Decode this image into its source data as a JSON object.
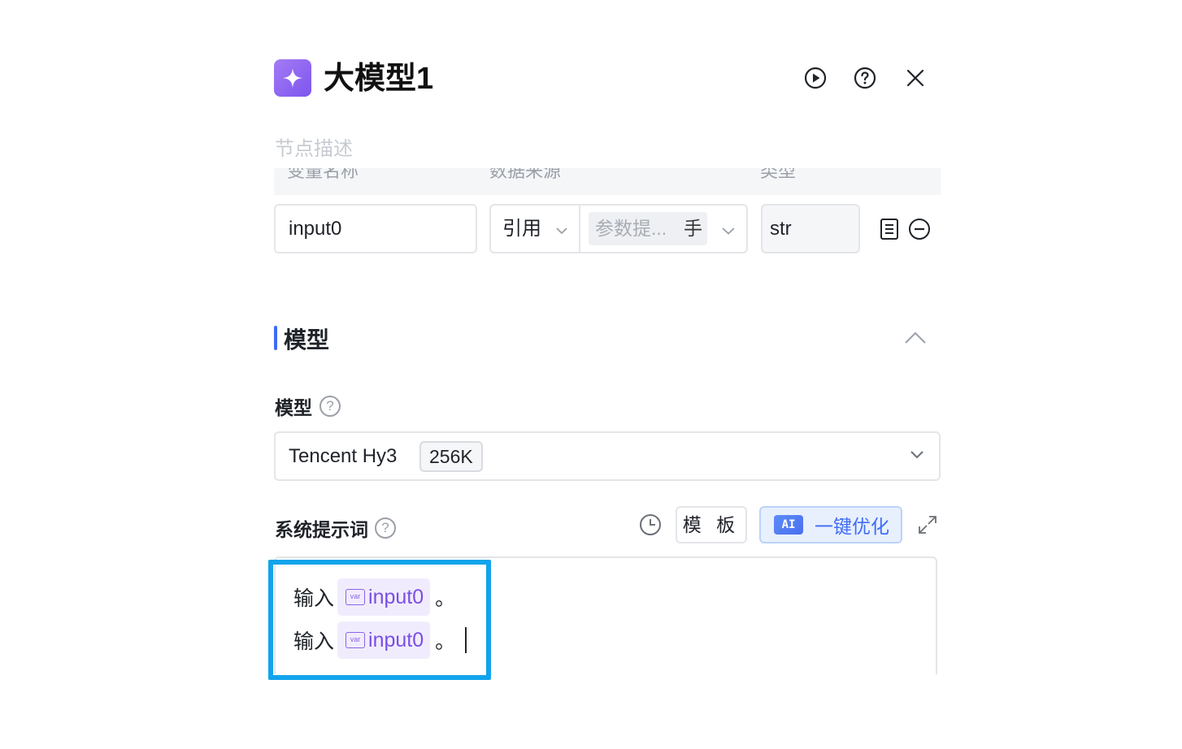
{
  "header": {
    "title": "大模型1",
    "run_icon": "play-circle-icon",
    "help_icon": "question-circle-icon",
    "close_icon": "close-icon"
  },
  "description": {
    "placeholder": "节点描述"
  },
  "table_header": [
    "变量名称",
    "数据来源",
    "类型"
  ],
  "input_row": {
    "name": "input0",
    "source_mode": "引用",
    "source_value": "参数提...",
    "source_value_tail": "手",
    "type": "str"
  },
  "section": {
    "title": "模型"
  },
  "model": {
    "label": "模型",
    "selected_name": "Tencent Hy3",
    "context_badge": "256K"
  },
  "system_prompt": {
    "label": "系统提示词",
    "template_button": "模 板",
    "ai_badge": "AI",
    "optimize_button": "一键优化",
    "lines": [
      {
        "prefix": "输入",
        "var": "input0",
        "var_tag": "var",
        "suffix": "。"
      },
      {
        "prefix": "输入",
        "var": "input0",
        "var_tag": "var",
        "suffix": "。"
      }
    ]
  },
  "colors": {
    "accent": "#3f6cf4",
    "node_icon": "#8b62f0",
    "highlight": "#12a4ec",
    "var_chip_text": "#7a4ee6"
  }
}
